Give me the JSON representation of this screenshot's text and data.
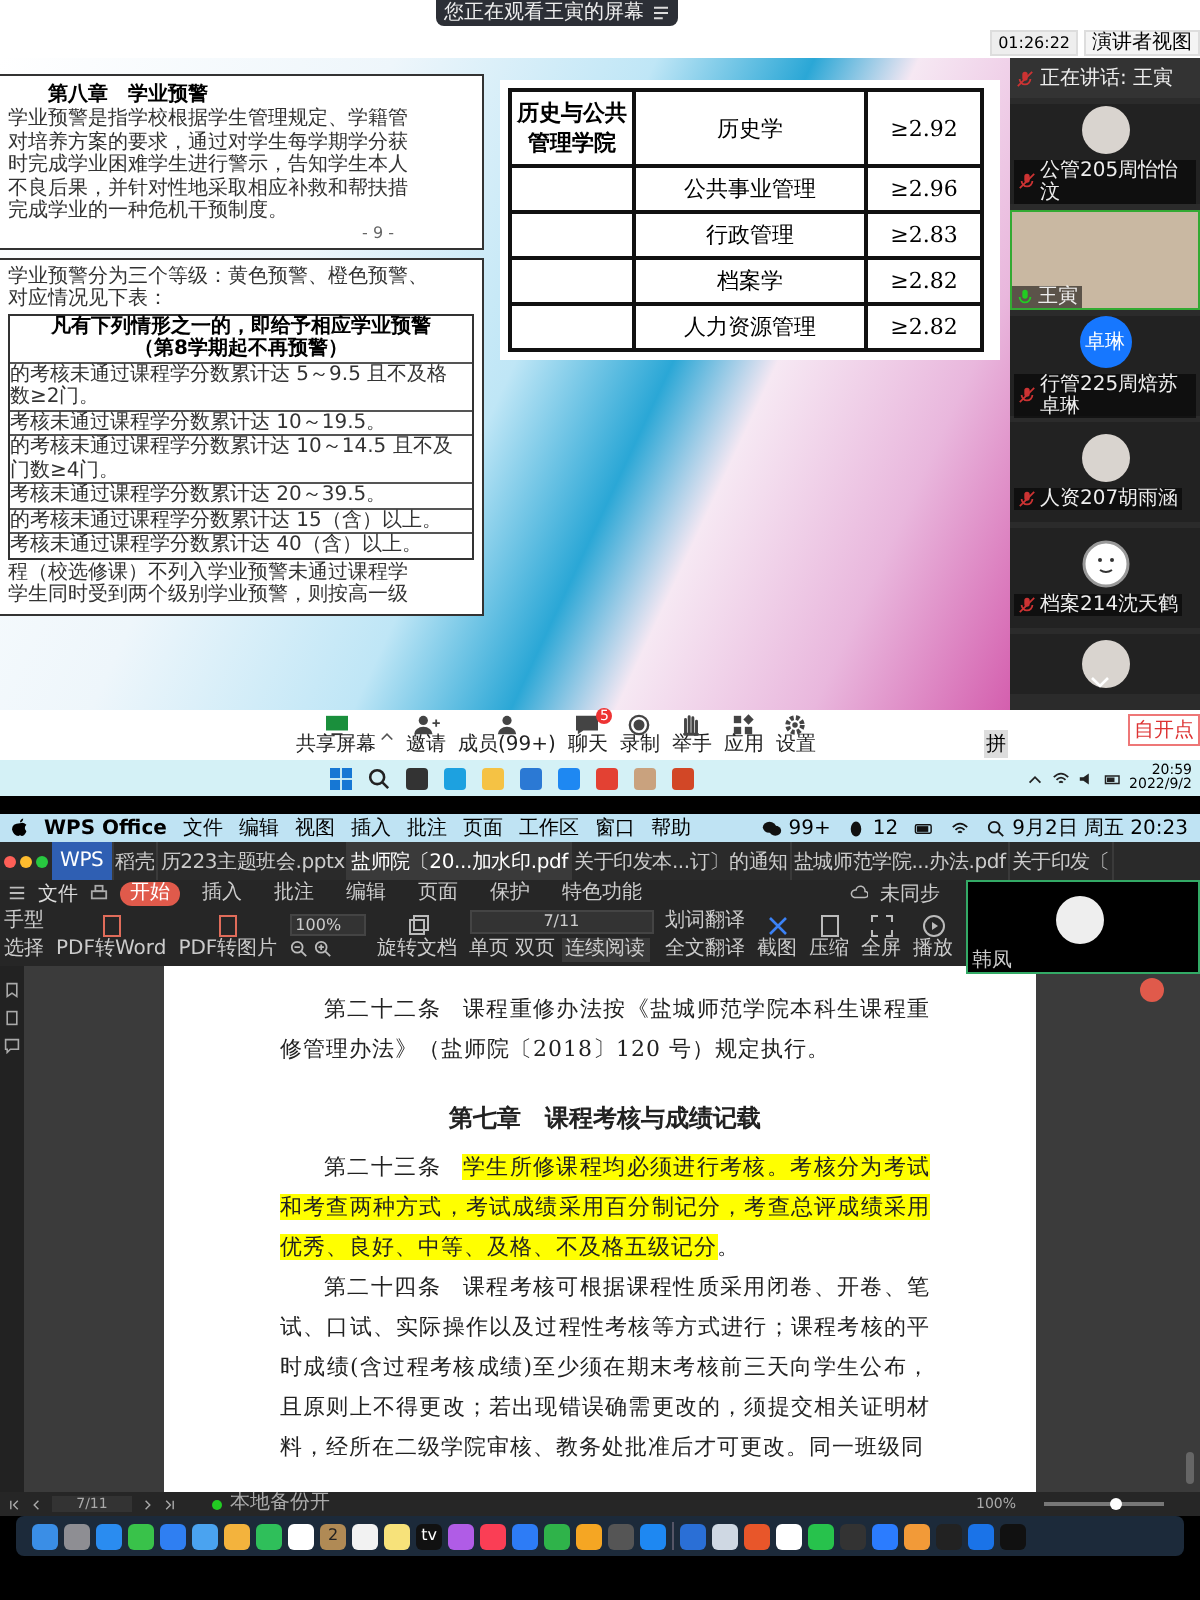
{
  "meeting": {
    "banner": "您正在观看王寅的屏幕",
    "timer": "01:26:22",
    "view_button": "演讲者视图",
    "doc_top": {
      "heading": "第八章　学业预警",
      "lines": [
        "学业预警是指学校根据学生管理规定、学籍管",
        "对培养方案的要求，通过对学生每学期学分获",
        "时完成学业困难学生进行警示，告知学生本人",
        "不良后果，并针对性地采取相应补救和帮扶措",
        "完成学业的一种危机干预制度。"
      ],
      "page_number": "- 9 -"
    },
    "doc_bottom": {
      "intro": [
        "学业预警分为三个等级：黄色预警、橙色预警、",
        "对应情况见下表："
      ],
      "table_header": [
        "凡有下列情形之一的，即给予相应学业预警",
        "（第8学期起不再预警）"
      ],
      "table_rows": [
        [
          "的考核未通过课程学分数累计达 5～9.5 且不及格",
          "数≥2门。"
        ],
        [
          "考核未通过课程学分数累计达 10～19.5。"
        ],
        [
          "的考核未通过课程学分数累计达 10～14.5 且不及",
          "门数≥4门。"
        ],
        [
          "考核未通过课程学分数累计达 20～39.5。"
        ],
        [
          "的考核未通过课程学分数累计达 15（含）以上。"
        ],
        [
          "考核未通过课程学分数累计达 40（含）以上。"
        ]
      ],
      "outro": [
        "程（校选修课）不列入学业预警未通过课程学",
        "学生同时受到两个级别学业预警，则按高一级"
      ]
    },
    "table": [
      {
        "college": "历史与公共管理学院",
        "major": "历史学",
        "requirement": "≥2.92"
      },
      {
        "major": "公共事业管理",
        "requirement": "≥2.96"
      },
      {
        "major": "行政管理",
        "requirement": "≥2.83"
      },
      {
        "major": "档案学",
        "requirement": "≥2.82"
      },
      {
        "major": "人力资源管理",
        "requirement": "≥2.82"
      }
    ],
    "speaking": "正在讲话: 王寅",
    "participants": [
      {
        "kind": "photo",
        "name": "公管205周怡怡汶",
        "muted": true
      },
      {
        "kind": "video",
        "name": "王寅",
        "muted": false
      },
      {
        "kind": "initials",
        "initials": "卓琳",
        "name": "行管225周焙苏卓琳",
        "muted": true
      },
      {
        "kind": "photo",
        "name": "人资207胡雨涵",
        "muted": true
      },
      {
        "kind": "smiley",
        "name": "档案214沈天鹤",
        "muted": true
      },
      {
        "kind": "photo_cut"
      }
    ],
    "toolbar": [
      {
        "kind": "share",
        "label": "共享屏幕"
      },
      {
        "kind": "invite",
        "label": "邀请"
      },
      {
        "kind": "members",
        "label": "成员(99+)"
      },
      {
        "kind": "chat",
        "label": "聊天",
        "badge": "5"
      },
      {
        "kind": "record",
        "label": "录制"
      },
      {
        "kind": "hand",
        "label": "举手"
      },
      {
        "kind": "apps",
        "label": "应用"
      },
      {
        "kind": "settings",
        "label": "设置"
      }
    ],
    "corner_button": "自开点",
    "ime": "拼"
  },
  "windows_taskbar": {
    "time": "20:59",
    "date": "2022/9/2"
  },
  "mac_menubar": {
    "app": "WPS Office",
    "menus": [
      "文件",
      "编辑",
      "视图",
      "插入",
      "批注",
      "页面",
      "工作区",
      "窗口",
      "帮助"
    ],
    "wechat_count": "99+",
    "qq_count": "12",
    "datetime": "9月2日 周五  20:23"
  },
  "wps": {
    "tabs": [
      {
        "kind": "home",
        "label": "WPS",
        "selected": false
      },
      {
        "kind": "file",
        "label": "稻壳",
        "selected": false
      },
      {
        "kind": "file",
        "label": "历223主题班会.pptx",
        "selected": false
      },
      {
        "kind": "file",
        "label": "盐师院〔20...加水印.pdf",
        "selected": true
      },
      {
        "kind": "file",
        "label": "关于印发本...订〕的通知",
        "selected": false
      },
      {
        "kind": "file",
        "label": "盐城师范学院...办法.pdf",
        "selected": false
      },
      {
        "kind": "file",
        "label": "关于印发〔",
        "selected": false
      }
    ],
    "file_menu": "文件",
    "ribbon_tabs": [
      {
        "label": "开始",
        "selected": true
      },
      {
        "label": "插入",
        "selected": false
      },
      {
        "label": "批注",
        "selected": false
      },
      {
        "label": "编辑",
        "selected": false
      },
      {
        "label": "页面",
        "selected": false
      },
      {
        "label": "保护",
        "selected": false
      },
      {
        "label": "特色功能",
        "selected": false
      }
    ],
    "sync": "未同步",
    "tools": {
      "hand": "手型",
      "select": "选择",
      "to_word": "PDF转Word",
      "to_image": "PDF转图片",
      "zoom": "100%",
      "rotate": "旋转文档",
      "page": "7/11",
      "single": "单页",
      "double": "双页",
      "continuous": "连续阅读",
      "word_translate": "划词翻译",
      "full_translate": "全文翻译",
      "screenshot": "截图",
      "compress": "压缩",
      "fullscreen": "全屏",
      "play": "播放"
    },
    "document": {
      "paragraphs": [
        {
          "label": "第二十二条",
          "text": "课程重修办法按《盐城师范学院本科生课程重修管理办法》（盐师院〔2018〕120 号）规定执行。",
          "highlighted": false
        },
        {
          "kind": "heading",
          "text": "第七章　课程考核与成绩记载"
        },
        {
          "label": "第二十三条",
          "text": "学生所修课程均必须进行考核。考核分为考试和考查两种方式，考试成绩采用百分制记分，考查总评成绩采用优秀、良好、中等、及格、不及格五级记分",
          "text_after": "。",
          "highlighted": true
        },
        {
          "label": "第二十四条",
          "text": "课程考核可根据课程性质采用闭卷、开卷、笔试、口试、实际操作以及过程性考核等方式进行；课程考核的平时成绩(含过程考核成绩)至少须在期末考核前三天向学生公布，且原则上不得更改；若出现错误确需更改的，须提交相关证明材料，经所在二级学院审核、教务处批准后才可更改。同一班级同",
          "highlighted": false
        }
      ]
    },
    "status": {
      "page": "7/11",
      "backup": "本地备份开",
      "zoom": "100%",
      "zoom_slider": {
        "level": 0.6
      }
    }
  },
  "video_overlay": {
    "name": "韩凤"
  },
  "dock": {
    "calendar_day": "2",
    "tv_label": "tv"
  }
}
